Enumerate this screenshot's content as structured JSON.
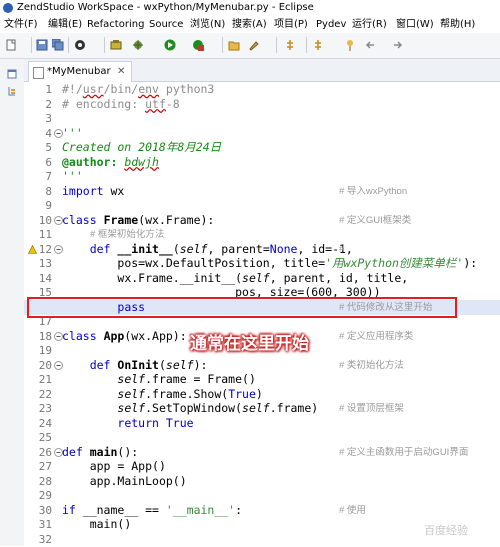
{
  "window": {
    "title": "ZendStudio WorkSpace - wxPython/MyMenubar.py - Eclipse"
  },
  "menubar": [
    {
      "label": "文件(F)"
    },
    {
      "label": "编辑(E)"
    },
    {
      "label": "Refactoring"
    },
    {
      "label": "Source"
    },
    {
      "label": "浏览(N)"
    },
    {
      "label": "搜索(A)"
    },
    {
      "label": "项目(P)"
    },
    {
      "label": "Pydev"
    },
    {
      "label": "运行(R)"
    },
    {
      "label": "窗口(W)"
    },
    {
      "label": "帮助(H)"
    }
  ],
  "toolbar_icons": [
    "new-icon",
    "save-icon",
    "save-all-icon",
    "profile-icon",
    "bulb-icon",
    "debug-icon",
    "run-icon",
    "external-tools-icon",
    "open-folder-icon",
    "brush-icon",
    "annotation-icon",
    "next-annotation-icon",
    "pin-icon",
    "back-icon",
    "forward-icon"
  ],
  "editor": {
    "tab_label": "*MyMenubar",
    "tab_close": "✕",
    "lines": [
      {
        "n": "1"
      },
      {
        "n": "2"
      },
      {
        "n": "3"
      },
      {
        "n": "4"
      },
      {
        "n": "5"
      },
      {
        "n": "6"
      },
      {
        "n": "7"
      },
      {
        "n": "8"
      },
      {
        "n": "9"
      },
      {
        "n": "10"
      },
      {
        "n": "11"
      },
      {
        "n": "12"
      },
      {
        "n": "13"
      },
      {
        "n": "14"
      },
      {
        "n": "15"
      },
      {
        "n": "16"
      },
      {
        "n": "17"
      },
      {
        "n": "18"
      },
      {
        "n": "19"
      },
      {
        "n": "20"
      },
      {
        "n": "21"
      },
      {
        "n": "22"
      },
      {
        "n": "23"
      },
      {
        "n": "24"
      },
      {
        "n": "25"
      },
      {
        "n": "26"
      },
      {
        "n": "27"
      },
      {
        "n": "28"
      },
      {
        "n": "29"
      },
      {
        "n": "30"
      },
      {
        "n": "31"
      },
      {
        "n": "32"
      }
    ],
    "text": {
      "l1_a": "#!/",
      "l1_b": "usr",
      "l1_c": "/bin/",
      "l1_d": "env",
      "l1_e": " python3",
      "l2_a": "# encoding: ",
      "l2_b": "utf",
      "l2_c": "-8",
      "l4": "'''",
      "l5_a": "Created on 2018",
      "l5_b": "年",
      "l5_c": "8",
      "l5_d": "月",
      "l5_e": "24",
      "l5_f": "日",
      "l6_a": "@author: ",
      "l6_b": "bdwjh",
      "l7": "'''",
      "l8_kw": "import",
      "l8_rest": " wx",
      "l10_kw": "class",
      "l10_fn": "Frame",
      "l10_rest": "(wx.Frame):",
      "l11": "# 框架初始化方法",
      "l12_kw": "def",
      "l12_fn": "__init__",
      "l12_a": "(",
      "l12_self": "self",
      "l12_b": ", parent=",
      "l12_none": "None",
      "l12_c": ", id=-1,",
      "l13_a": "pos=wx.DefaultPosition, title=",
      "l13_str": "'用wxPython创建菜单栏'",
      "l13_b": "):",
      "l14_a": "wx.Frame.__init__(",
      "l14_self": "self",
      "l14_b": ", parent, id, title,",
      "l15_a": "pos, size=(",
      "l15_num": "600, 300",
      "l15_b": "))",
      "l16_kw": "pass",
      "l18_kw": "class",
      "l18_fn": "App",
      "l18_rest": "(wx.App):",
      "l20_kw": "def",
      "l20_fn": "OnInit",
      "l20_a": "(",
      "l20_self": "self",
      "l20_b": "):",
      "l21_self": "self",
      "l21_rest": ".frame = Frame()",
      "l22_self": "self",
      "l22_a": ".frame.Show(",
      "l22_true": "True",
      "l22_b": ")",
      "l23_self": "self",
      "l23_a": ".SetTopWindow(",
      "l23_self2": "self",
      "l23_b": ".frame)",
      "l24_kw": "return",
      "l24_true": "True",
      "l26_kw": "def",
      "l26_fn": "main",
      "l26_rest": "():",
      "l27": "app = App()",
      "l28": "app.MainLoop()",
      "l30_kw": "if",
      "l30_a": " __name__ == ",
      "l30_str": "'__main__'",
      "l30_b": ":",
      "l31": "main()"
    },
    "comments": {
      "c8": "#  导入wxPython",
      "c10": "#  定义GUI框架类",
      "c12": "#",
      "c16": "#  代码修改从这里开始",
      "c18": "#  定义应用程序类",
      "c20": "#  类初始化方法",
      "c23": "#  设置顶层框架",
      "c26": "#  定义主函数用于启动GUI界面",
      "c30": "#  使用"
    }
  },
  "annotation": {
    "text": "通常在这里开始"
  },
  "watermark": {
    "text": "百度经验"
  },
  "colors": {
    "highlight_box": "#e02020",
    "keyword": "#0000cc",
    "comment": "#9a9a9a",
    "docstring": "#1a8a1a"
  }
}
